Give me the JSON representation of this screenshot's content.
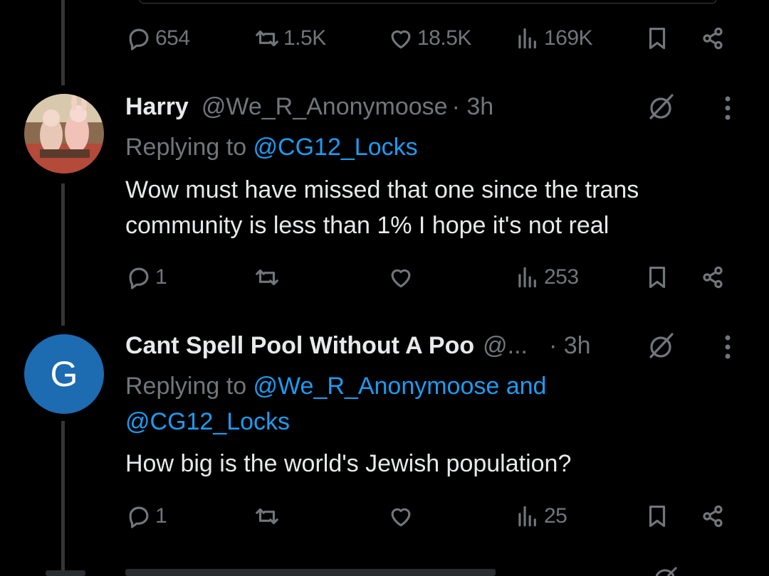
{
  "top_tweet": {
    "actions": {
      "replies": "654",
      "reposts": "1.5K",
      "likes": "18.5K",
      "views": "169K"
    }
  },
  "replies": [
    {
      "name": "Harry",
      "handle": "@We_R_Anonymoose",
      "time": "· 3h",
      "replying_prefix": "Replying to ",
      "replying_to": "@CG12_Locks",
      "text_line1": "Wow must have missed that one since the trans",
      "text_line2": "community is less than 1% I hope it's not real",
      "actions": {
        "replies": "1",
        "reposts": "",
        "likes": "",
        "views": "253"
      }
    },
    {
      "avatar_letter": "G",
      "name": "Cant Spell Pool Without A Poo",
      "handle": "@...",
      "time": "· 3h",
      "replying_prefix": "Replying to ",
      "replying_to_line1": "@We_R_Anonymoose and",
      "replying_to_line2": "@CG12_Locks",
      "text_line1": "How big is the world's Jewish population?",
      "actions": {
        "replies": "1",
        "reposts": "",
        "likes": "",
        "views": "25"
      }
    }
  ],
  "colors": {
    "background": "#000000",
    "text": "#e7e9ea",
    "muted": "#71767b",
    "link": "#1d9bf0",
    "avatar_g": "#1d6bb1"
  }
}
